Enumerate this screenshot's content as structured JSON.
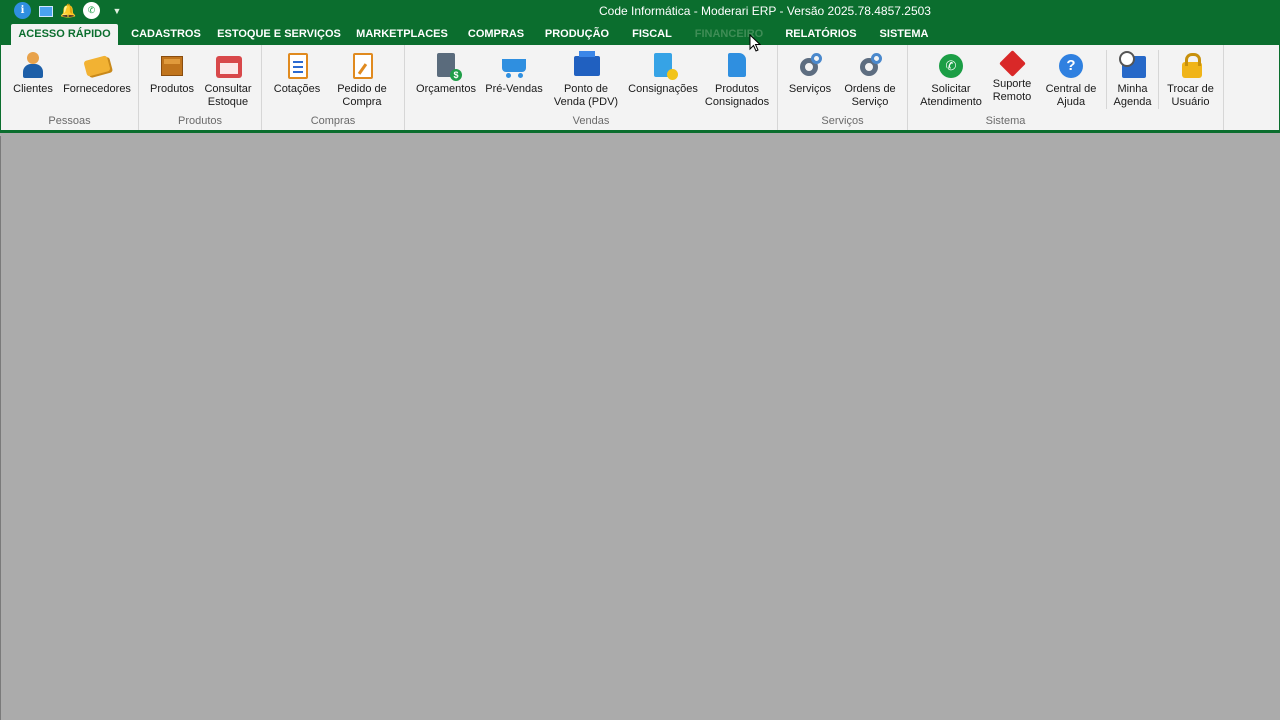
{
  "titlebar": {
    "title": "Code Informática - Moderari ERP - Versão 2025.78.4857.2503",
    "qat_icons": [
      "info-icon",
      "screen-icon",
      "bell-icon",
      "whatsapp-icon",
      "customize-icon"
    ]
  },
  "tabs": [
    {
      "label": "ACESSO RÁPIDO",
      "active": true
    },
    {
      "label": "CADASTROS"
    },
    {
      "label": "ESTOQUE E SERVIÇOS"
    },
    {
      "label": "MARKETPLACES"
    },
    {
      "label": "COMPRAS"
    },
    {
      "label": "PRODUÇÃO"
    },
    {
      "label": "FISCAL"
    },
    {
      "label": "FINANCEIRO"
    },
    {
      "label": "RELATÓRIOS"
    },
    {
      "label": "SISTEMA"
    }
  ],
  "ribbon": {
    "groups": [
      {
        "label": "Pessoas",
        "buttons": [
          {
            "label": "Clientes",
            "icon": "clients-icon"
          },
          {
            "label": "Fornecedores",
            "icon": "suppliers-icon"
          }
        ]
      },
      {
        "label": "Produtos",
        "buttons": [
          {
            "label": "Produtos",
            "icon": "products-icon"
          },
          {
            "label": "Consultar\nEstoque",
            "icon": "stock-icon"
          }
        ]
      },
      {
        "label": "Compras",
        "buttons": [
          {
            "label": "Cotações",
            "icon": "quotes-icon"
          },
          {
            "label": "Pedido de\nCompra",
            "icon": "purchase-order-icon"
          }
        ]
      },
      {
        "label": "Vendas",
        "buttons": [
          {
            "label": "Orçamentos",
            "icon": "budget-icon"
          },
          {
            "label": "Pré-Vendas",
            "icon": "cart-icon"
          },
          {
            "label": "Ponto de\nVenda (PDV)",
            "icon": "pos-icon"
          },
          {
            "label": "Consignações",
            "icon": "consignment-icon"
          },
          {
            "label": "Produtos\nConsignados",
            "icon": "consigned-products-icon"
          }
        ]
      },
      {
        "label": "Serviços",
        "buttons": [
          {
            "label": "Serviços",
            "icon": "services-gear-icon"
          },
          {
            "label": "Ordens de\nServiço",
            "icon": "service-order-icon"
          }
        ]
      },
      {
        "label": "Sistema",
        "buttons": [
          {
            "label": "Solicitar\nAtendimento",
            "icon": "whatsapp-icon"
          },
          {
            "label": "Suporte\nRemoto",
            "icon": "remote-support-icon"
          },
          {
            "label": "Central de\nAjuda",
            "icon": "help-icon"
          },
          {
            "label": "Minha\nAgenda",
            "icon": "calendar-icon"
          },
          {
            "label": "Trocar de\nUsuário",
            "icon": "lock-icon"
          }
        ]
      }
    ]
  },
  "colors": {
    "brand_green": "#0b6e2e",
    "ribbon_bg": "#f3f3f3",
    "workspace": "#ababab"
  }
}
